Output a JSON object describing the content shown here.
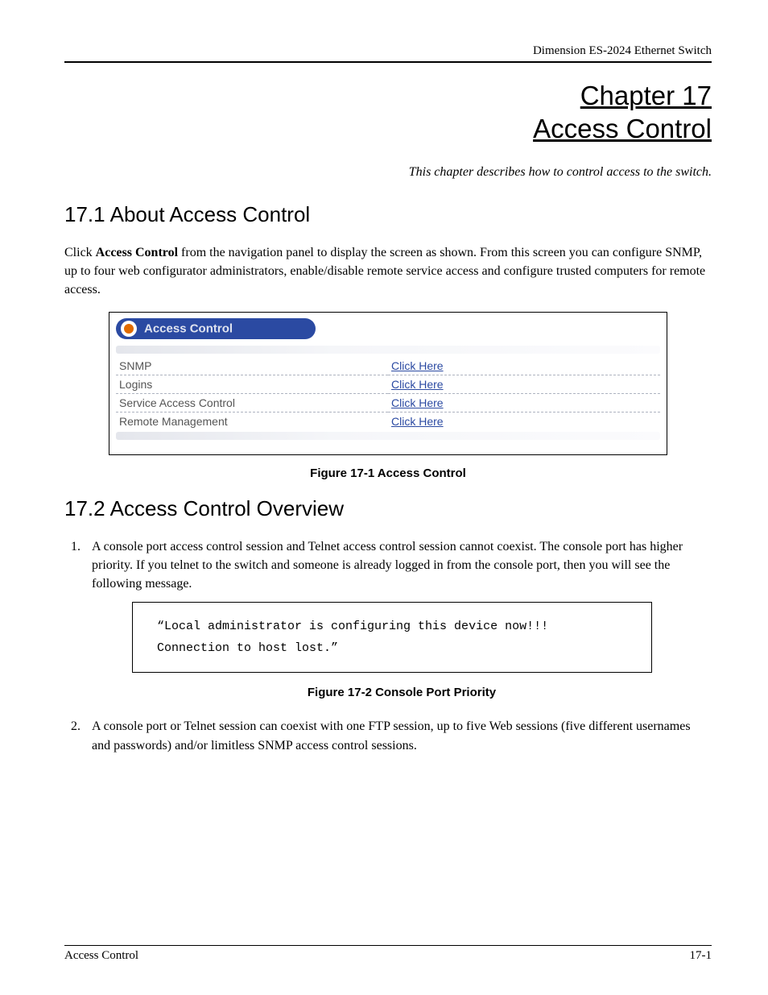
{
  "header": {
    "product": "Dimension ES-2024 Ethernet Switch"
  },
  "chapter": {
    "line1": "Chapter 17",
    "line2": "Access Control",
    "description": "This chapter describes how to control access to the switch."
  },
  "section1": {
    "number": "17.1",
    "title": "About Access Control",
    "para_pre": "Click ",
    "para_bold": "Access Control",
    "para_post": " from the navigation panel to display the screen as shown. From this screen you can configure SNMP, up to four web configurator administrators, enable/disable remote service access and configure trusted computers for remote access."
  },
  "figure1": {
    "panel_title": "Access Control",
    "rows": [
      {
        "label": "SNMP",
        "link": "Click Here"
      },
      {
        "label": "Logins",
        "link": "Click Here"
      },
      {
        "label": "Service Access Control",
        "link": "Click Here"
      },
      {
        "label": "Remote Management",
        "link": "Click Here"
      }
    ],
    "caption": "Figure 17-1 Access Control"
  },
  "section2": {
    "number": "17.2",
    "title": "Access Control Overview",
    "item1": "A console port access control session and Telnet access control session cannot coexist. The console port has higher priority. If you telnet to the switch and someone is already logged in from the console port, then you will see the following message.",
    "code_line1": "“Local administrator is configuring this device now!!!",
    "code_line2": "Connection to host lost.”",
    "caption2": "Figure 17-2 Console Port Priority",
    "item2": "A console port or Telnet session can coexist with one FTP session, up to five Web sessions (five different usernames and passwords) and/or limitless SNMP access control sessions."
  },
  "footer": {
    "left": "Access Control",
    "right": "17-1"
  }
}
